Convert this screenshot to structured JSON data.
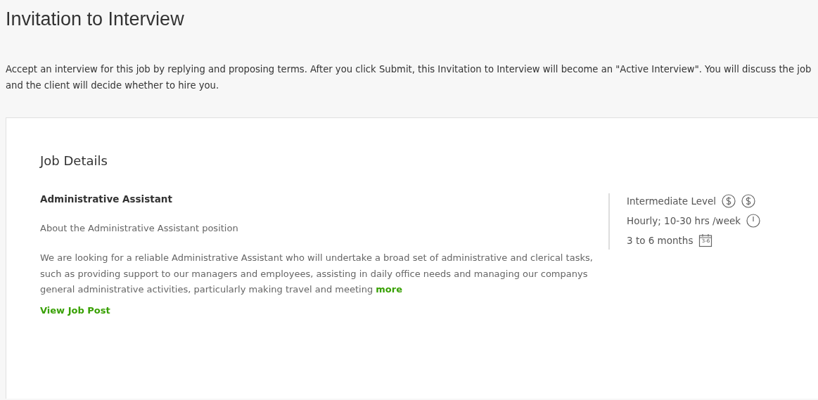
{
  "page": {
    "title": "Invitation to Interview",
    "intro": "Accept an interview for this job by replying and proposing terms. After you click Submit, this Invitation to Interview will become an \"Active Interview\". You will discuss the job and the client will decide whether to hire you."
  },
  "job_details": {
    "heading": "Job Details",
    "job_title": "Administrative Assistant",
    "subtitle": "About the Administrative Assistant position",
    "description": "We are looking for a reliable Administrative Assistant who will undertake a broad set of administrative and clerical tasks, such as providing support to our managers and employees, assisting in daily office needs and managing our companys general administrative activities, particularly making travel and meeting",
    "more_link": "more",
    "view_link": "View Job Post",
    "facts": [
      {
        "kind": "level",
        "text": "Intermediate Level"
      },
      {
        "kind": "hours",
        "text": "Hourly; 10-30 hrs /week"
      },
      {
        "kind": "duration",
        "text": "3 to 6 months",
        "icon_label": "3-6"
      }
    ]
  }
}
